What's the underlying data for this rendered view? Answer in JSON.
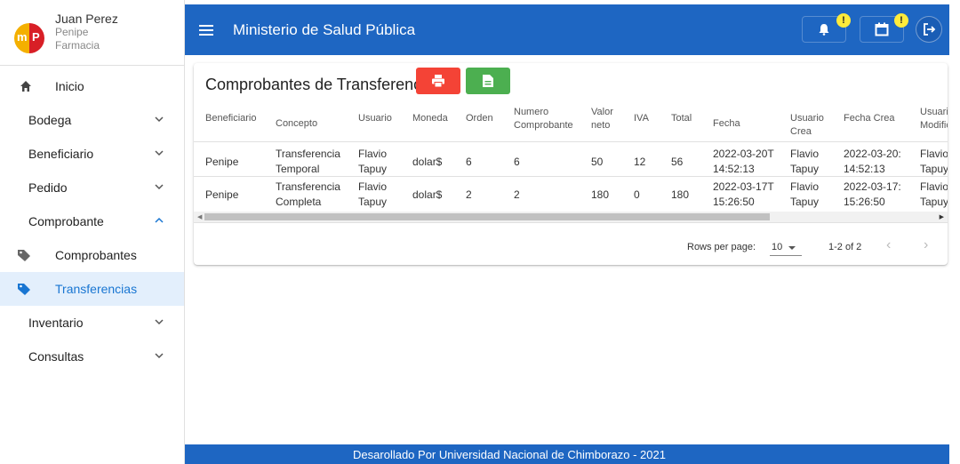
{
  "user": {
    "name": "Juan Perez",
    "city": "Penipe",
    "unit": "Farmacia",
    "logo_letters": [
      "m",
      "P"
    ]
  },
  "nav": {
    "home": "Inicio",
    "items": [
      "Bodega",
      "Beneficiario",
      "Pedido",
      "Comprobante"
    ],
    "subitems": [
      "Comprobantes",
      "Transferencias"
    ],
    "items_after": [
      "Inventario",
      "Consultas"
    ]
  },
  "header": {
    "title": "Ministerio de Salud Pública",
    "badge_bell": "!",
    "badge_calendar": "!"
  },
  "card": {
    "title": "Comprobantes de Transferencias",
    "columns": [
      "Beneficiario",
      "Concepto",
      "Usuario",
      "Moneda",
      "Orden",
      "Numero Comprobante",
      "Valor neto",
      "IVA",
      "Total",
      "Fecha",
      "Usuario Crea",
      "Fecha Crea",
      "Usuario Modifica"
    ],
    "rows": [
      [
        "Penipe",
        "Transferencia Temporal",
        "Flavio Tapuy",
        "dolar$",
        "6",
        "6",
        "50",
        "12",
        "56",
        "2022-03-20T14:52:13",
        "Flavio Tapuy",
        "2022-03-20:14:52:13",
        "Flavio Tapuy"
      ],
      [
        "Penipe",
        "Transferencia Completa",
        "Flavio Tapuy",
        "dolar$",
        "2",
        "2",
        "180",
        "0",
        "180",
        "2022-03-17T15:26:50",
        "Flavio Tapuy",
        "2022-03-17:15:26:50",
        "Flavio Tapuy"
      ]
    ],
    "rows_per_page_label": "Rows per page:",
    "rows_per_page": "10",
    "range": "1-2 of 2"
  },
  "footer": {
    "text": "Desarollado Por Universidad Nacional de Chimborazo - 2021"
  },
  "colors": {
    "primary": "#1e66c2",
    "print_button": "#f44336",
    "doc_button": "#4caf50",
    "badge": "#ffeb3b",
    "active_bg": "#e3effc",
    "active_text": "#1976d2"
  },
  "icons": {
    "menu": "hamburger-icon",
    "bell": "bell-icon",
    "calendar": "calendar-icon",
    "logout": "logout-icon",
    "home": "home-icon",
    "tag": "tag-icon",
    "print": "printer-icon",
    "doc": "document-icon",
    "chevron": "chevron-down-icon"
  }
}
